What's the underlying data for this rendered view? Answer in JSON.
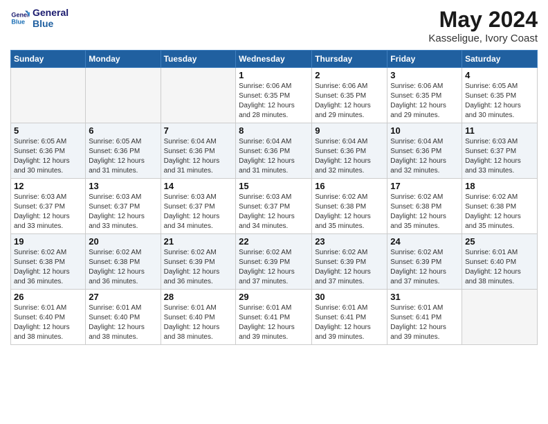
{
  "header": {
    "logo_line1": "General",
    "logo_line2": "Blue",
    "month_year": "May 2024",
    "location": "Kasseligue, Ivory Coast"
  },
  "weekdays": [
    "Sunday",
    "Monday",
    "Tuesday",
    "Wednesday",
    "Thursday",
    "Friday",
    "Saturday"
  ],
  "weeks": [
    [
      {
        "day": "",
        "info": ""
      },
      {
        "day": "",
        "info": ""
      },
      {
        "day": "",
        "info": ""
      },
      {
        "day": "1",
        "info": "Sunrise: 6:06 AM\nSunset: 6:35 PM\nDaylight: 12 hours\nand 28 minutes."
      },
      {
        "day": "2",
        "info": "Sunrise: 6:06 AM\nSunset: 6:35 PM\nDaylight: 12 hours\nand 29 minutes."
      },
      {
        "day": "3",
        "info": "Sunrise: 6:06 AM\nSunset: 6:35 PM\nDaylight: 12 hours\nand 29 minutes."
      },
      {
        "day": "4",
        "info": "Sunrise: 6:05 AM\nSunset: 6:35 PM\nDaylight: 12 hours\nand 30 minutes."
      }
    ],
    [
      {
        "day": "5",
        "info": "Sunrise: 6:05 AM\nSunset: 6:36 PM\nDaylight: 12 hours\nand 30 minutes."
      },
      {
        "day": "6",
        "info": "Sunrise: 6:05 AM\nSunset: 6:36 PM\nDaylight: 12 hours\nand 31 minutes."
      },
      {
        "day": "7",
        "info": "Sunrise: 6:04 AM\nSunset: 6:36 PM\nDaylight: 12 hours\nand 31 minutes."
      },
      {
        "day": "8",
        "info": "Sunrise: 6:04 AM\nSunset: 6:36 PM\nDaylight: 12 hours\nand 31 minutes."
      },
      {
        "day": "9",
        "info": "Sunrise: 6:04 AM\nSunset: 6:36 PM\nDaylight: 12 hours\nand 32 minutes."
      },
      {
        "day": "10",
        "info": "Sunrise: 6:04 AM\nSunset: 6:36 PM\nDaylight: 12 hours\nand 32 minutes."
      },
      {
        "day": "11",
        "info": "Sunrise: 6:03 AM\nSunset: 6:37 PM\nDaylight: 12 hours\nand 33 minutes."
      }
    ],
    [
      {
        "day": "12",
        "info": "Sunrise: 6:03 AM\nSunset: 6:37 PM\nDaylight: 12 hours\nand 33 minutes."
      },
      {
        "day": "13",
        "info": "Sunrise: 6:03 AM\nSunset: 6:37 PM\nDaylight: 12 hours\nand 33 minutes."
      },
      {
        "day": "14",
        "info": "Sunrise: 6:03 AM\nSunset: 6:37 PM\nDaylight: 12 hours\nand 34 minutes."
      },
      {
        "day": "15",
        "info": "Sunrise: 6:03 AM\nSunset: 6:37 PM\nDaylight: 12 hours\nand 34 minutes."
      },
      {
        "day": "16",
        "info": "Sunrise: 6:02 AM\nSunset: 6:38 PM\nDaylight: 12 hours\nand 35 minutes."
      },
      {
        "day": "17",
        "info": "Sunrise: 6:02 AM\nSunset: 6:38 PM\nDaylight: 12 hours\nand 35 minutes."
      },
      {
        "day": "18",
        "info": "Sunrise: 6:02 AM\nSunset: 6:38 PM\nDaylight: 12 hours\nand 35 minutes."
      }
    ],
    [
      {
        "day": "19",
        "info": "Sunrise: 6:02 AM\nSunset: 6:38 PM\nDaylight: 12 hours\nand 36 minutes."
      },
      {
        "day": "20",
        "info": "Sunrise: 6:02 AM\nSunset: 6:38 PM\nDaylight: 12 hours\nand 36 minutes."
      },
      {
        "day": "21",
        "info": "Sunrise: 6:02 AM\nSunset: 6:39 PM\nDaylight: 12 hours\nand 36 minutes."
      },
      {
        "day": "22",
        "info": "Sunrise: 6:02 AM\nSunset: 6:39 PM\nDaylight: 12 hours\nand 37 minutes."
      },
      {
        "day": "23",
        "info": "Sunrise: 6:02 AM\nSunset: 6:39 PM\nDaylight: 12 hours\nand 37 minutes."
      },
      {
        "day": "24",
        "info": "Sunrise: 6:02 AM\nSunset: 6:39 PM\nDaylight: 12 hours\nand 37 minutes."
      },
      {
        "day": "25",
        "info": "Sunrise: 6:01 AM\nSunset: 6:40 PM\nDaylight: 12 hours\nand 38 minutes."
      }
    ],
    [
      {
        "day": "26",
        "info": "Sunrise: 6:01 AM\nSunset: 6:40 PM\nDaylight: 12 hours\nand 38 minutes."
      },
      {
        "day": "27",
        "info": "Sunrise: 6:01 AM\nSunset: 6:40 PM\nDaylight: 12 hours\nand 38 minutes."
      },
      {
        "day": "28",
        "info": "Sunrise: 6:01 AM\nSunset: 6:40 PM\nDaylight: 12 hours\nand 38 minutes."
      },
      {
        "day": "29",
        "info": "Sunrise: 6:01 AM\nSunset: 6:41 PM\nDaylight: 12 hours\nand 39 minutes."
      },
      {
        "day": "30",
        "info": "Sunrise: 6:01 AM\nSunset: 6:41 PM\nDaylight: 12 hours\nand 39 minutes."
      },
      {
        "day": "31",
        "info": "Sunrise: 6:01 AM\nSunset: 6:41 PM\nDaylight: 12 hours\nand 39 minutes."
      },
      {
        "day": "",
        "info": ""
      }
    ]
  ]
}
